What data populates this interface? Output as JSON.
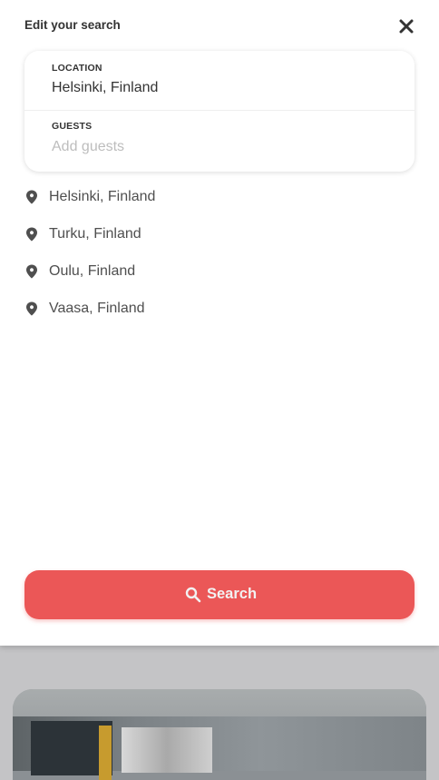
{
  "header": {
    "title": "Edit your search",
    "close_icon": "close-icon"
  },
  "search_form": {
    "location": {
      "label": "LOCATION",
      "value": "Helsinki, Finland"
    },
    "guests": {
      "label": "GUESTS",
      "value": "",
      "placeholder": "Add guests"
    }
  },
  "suggestions": [
    {
      "label": "Helsinki, Finland",
      "icon": "location-pin-icon"
    },
    {
      "label": "Turku, Finland",
      "icon": "location-pin-icon"
    },
    {
      "label": "Oulu, Finland",
      "icon": "location-pin-icon"
    },
    {
      "label": "Vaasa, Finland",
      "icon": "location-pin-icon"
    }
  ],
  "search_button": {
    "label": "Search",
    "icon": "search-icon"
  },
  "colors": {
    "accent": "#eb5757",
    "text_primary": "#333333",
    "text_secondary": "#4f4f4f",
    "placeholder": "#bdbdbd",
    "backdrop": "#c4c4c6"
  }
}
